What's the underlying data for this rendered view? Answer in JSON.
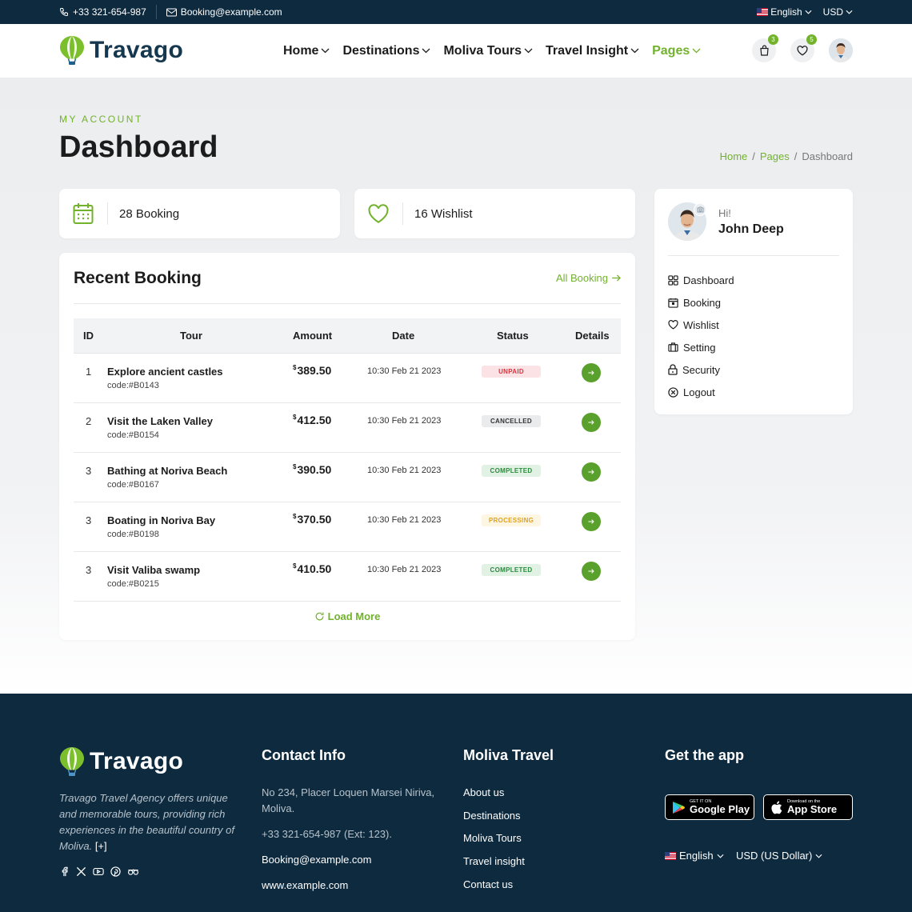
{
  "topbar": {
    "phone": "+33 321-654-987",
    "email": "Booking@example.com",
    "language": "English",
    "currency": "USD"
  },
  "header": {
    "brand": "Travago",
    "nav": [
      {
        "label": "Home"
      },
      {
        "label": "Destinations"
      },
      {
        "label": "Moliva Tours"
      },
      {
        "label": "Travel Insight"
      },
      {
        "label": "Pages"
      }
    ],
    "cart_count": "3",
    "wishlist_count": "5"
  },
  "page": {
    "eyebrow": "MY ACCOUNT",
    "title": "Dashboard",
    "breadcrumb": [
      "Home",
      "Pages",
      "Dashboard"
    ]
  },
  "stats": {
    "booking": "28 Booking",
    "wishlist": "16 Wishlist"
  },
  "recent": {
    "title": "Recent Booking",
    "all_link": "All Booking",
    "columns": [
      "ID",
      "Tour",
      "Amount",
      "Date",
      "Status",
      "Details"
    ],
    "currency_symbol": "$",
    "rows": [
      {
        "id": "1",
        "tour": "Explore ancient castles",
        "code": "code:#B0143",
        "amount": "389.50",
        "date": "10:30 Feb 21 2023",
        "status": "UNPAID"
      },
      {
        "id": "2",
        "tour": "Visit the Laken Valley",
        "code": "code:#B0154",
        "amount": "412.50",
        "date": "10:30 Feb 21 2023",
        "status": "CANCELLED"
      },
      {
        "id": "3",
        "tour": "Bathing at Noriva Beach",
        "code": "code:#B0167",
        "amount": "390.50",
        "date": "10:30 Feb 21 2023",
        "status": "COMPLETED"
      },
      {
        "id": "3",
        "tour": "Boating in Noriva Bay",
        "code": "code:#B0198",
        "amount": "370.50",
        "date": "10:30 Feb 21 2023",
        "status": "PROCESSING"
      },
      {
        "id": "3",
        "tour": "Visit Valiba swamp",
        "code": "code:#B0215",
        "amount": "410.50",
        "date": "10:30 Feb 21 2023",
        "status": "COMPLETED"
      }
    ],
    "load_more": "Load More"
  },
  "profile": {
    "greeting": "Hi!",
    "name": "John Deep",
    "menu": [
      {
        "label": "Dashboard",
        "icon": "grid-icon"
      },
      {
        "label": "Booking",
        "icon": "calendar-icon"
      },
      {
        "label": "Wishlist",
        "icon": "heart-icon"
      },
      {
        "label": "Setting",
        "icon": "briefcase-icon"
      },
      {
        "label": "Security",
        "icon": "lock-icon"
      },
      {
        "label": "Logout",
        "icon": "close-circle-icon"
      }
    ]
  },
  "footer": {
    "brand": "Travago",
    "description": "Travago Travel Agency offers unique and memorable tours, providing rich experiences in the beautiful country of Moliva.",
    "more": "[+]",
    "contact_title": "Contact Info",
    "address": "No 234, Placer Loquen Marsei Niriva, Moliva.",
    "phone": "+33 321-654-987 (Ext: 123).",
    "email": "Booking@example.com",
    "website": "www.example.com",
    "links_title": "Moliva Travel",
    "links": [
      "About us",
      "Destinations",
      "Moliva Tours",
      "Travel insight",
      "Contact us"
    ],
    "app_title": "Get the app",
    "google_small": "GET IT ON",
    "google_big": "Google Play",
    "apple_small": "Download on the",
    "apple_big": "App Store",
    "language": "English",
    "currency": "USD (US Dollar)"
  },
  "colors": {
    "accent": "#72b22d",
    "dark": "#0d2a3f"
  }
}
